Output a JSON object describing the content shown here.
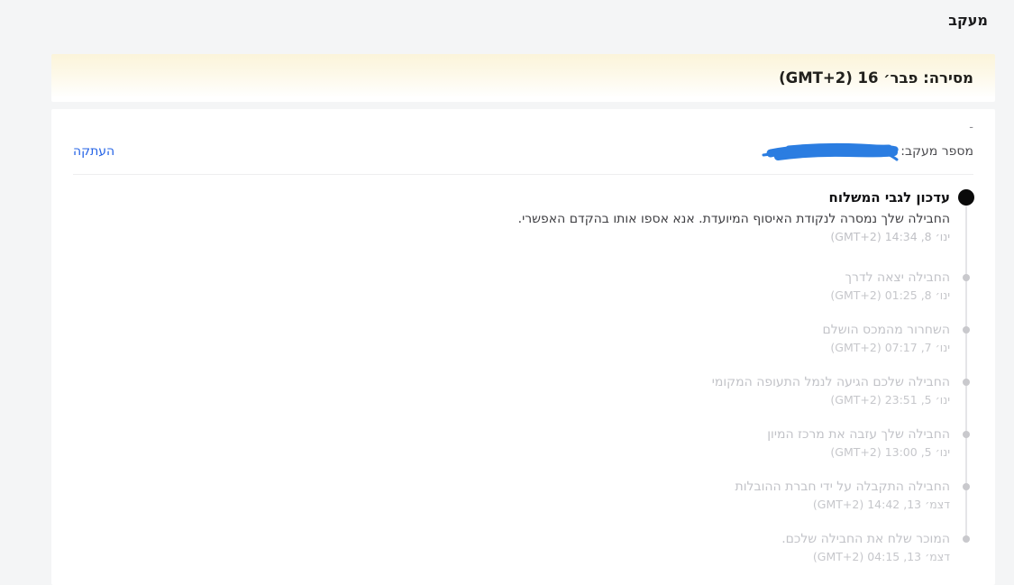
{
  "page": {
    "title": "מעקב"
  },
  "banner": {
    "text": "מסירה: פבר׳ 16 (GMT+2)"
  },
  "tracking": {
    "dash": "-",
    "label": "מספר מעקב:",
    "copy_label": "העתקה"
  },
  "timeline": {
    "entries": [
      {
        "title": "עדכון לגבי המשלוח",
        "body": "החבילה שלך נמסרה לנקודת האיסוף המיועדת. אנא אספו אותו בהקדם האפשרי.",
        "time": "ינו׳ 8, 14:34 (GMT+2)",
        "state": "active"
      },
      {
        "title": "החבילה יצאה לדרך",
        "time": "ינו׳ 8, 01:25 (GMT+2)",
        "state": "past"
      },
      {
        "title": "השחרור מהמכס הושלם",
        "time": "ינו׳ 7, 07:17 (GMT+2)",
        "state": "past"
      },
      {
        "title": "החבילה שלכם הגיעה לנמל התעופה המקומי",
        "time": "ינו׳ 5, 23:51 (GMT+2)",
        "state": "past"
      },
      {
        "title": "החבילה שלך עזבה את מרכז המיון",
        "time": "ינו׳ 5, 13:00 (GMT+2)",
        "state": "past"
      },
      {
        "title": "החבילה התקבלה על ידי חברת ההובלות",
        "time": "דצמ׳ 13, 14:42 (GMT+2)",
        "state": "past"
      },
      {
        "title": "המוכר שלח את החבילה שלכם.",
        "time": "דצמ׳ 13, 04:15 (GMT+2)",
        "state": "past"
      }
    ]
  },
  "colors": {
    "page_bg": "#f4f5f6",
    "banner_cream": "#fbf4da",
    "accent_blue": "#2463e6",
    "redaction_blue": "#2b7de1",
    "active_dot": "#0a0a0a",
    "muted_text": "#c2c3c8"
  }
}
